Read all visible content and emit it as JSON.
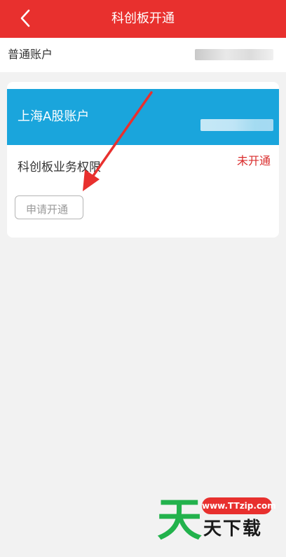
{
  "header": {
    "title": "科创板开通",
    "back_icon": "chevron-left-icon",
    "background_color": "#e8302e"
  },
  "account_row": {
    "label": "普通账户",
    "value_masked": true
  },
  "card": {
    "header_color": "#1aa5dc",
    "title": "上海A股账户",
    "account_number_masked": true,
    "permission_label": "科创板业务权限",
    "status": "未开通",
    "status_color": "#d92b2b",
    "apply_button_label": "申请开通"
  },
  "annotation": {
    "arrow_color": "#e8302e"
  },
  "watermark": {
    "url": "www.TTzip.com",
    "name": "天下载",
    "logo_glyph": "天",
    "logo_color": "#22b24c"
  }
}
